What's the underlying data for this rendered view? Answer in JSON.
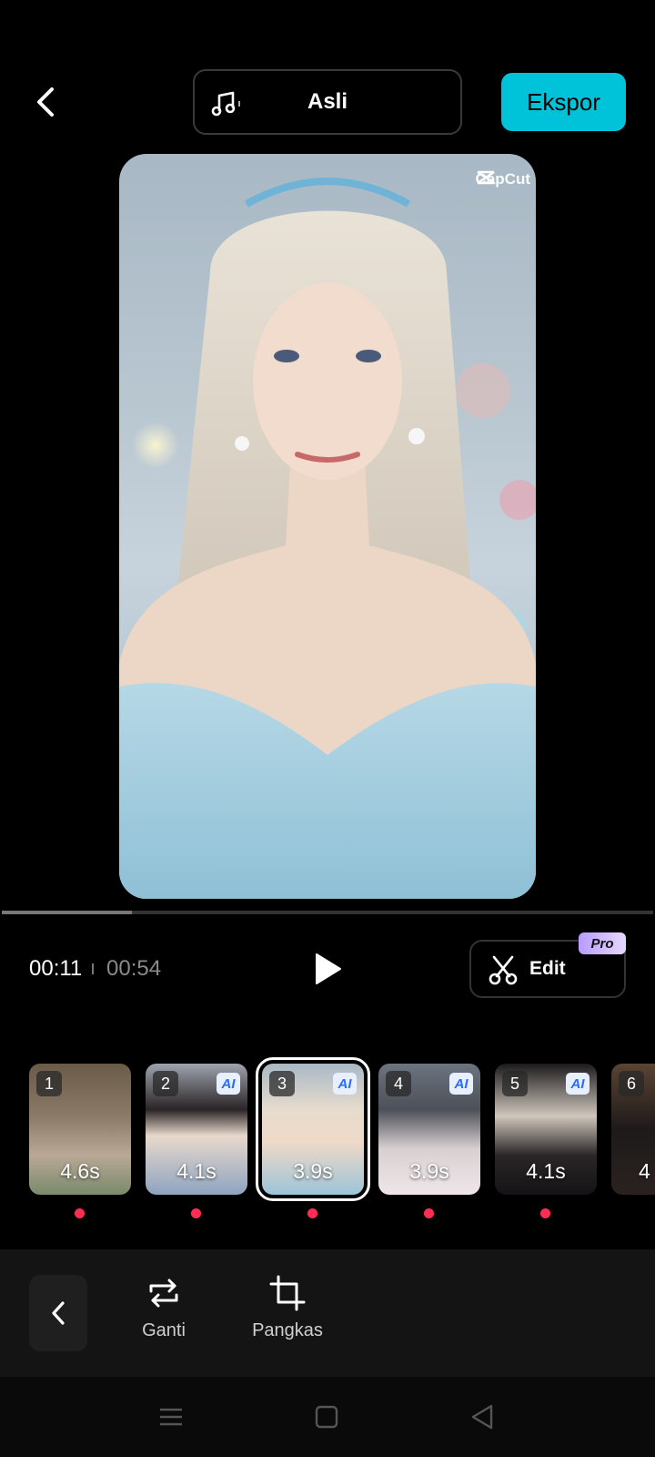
{
  "header": {
    "back_icon": "chevron-left-icon",
    "music_icon": "music-note-icon",
    "music_label": "Asli",
    "export_label": "Ekspor",
    "accent_color": "#00c3d9"
  },
  "preview": {
    "watermark": "CapCut"
  },
  "playback": {
    "current_time": "00:11",
    "total_time": "00:54",
    "progress": 0.2,
    "play_icon": "play-icon"
  },
  "edit": {
    "label": "Edit",
    "badge": "Pro",
    "icon": "scissors-icon"
  },
  "clips": [
    {
      "number": "1",
      "duration": "4.6s",
      "ai": false,
      "selected": false
    },
    {
      "number": "2",
      "duration": "4.1s",
      "ai": true,
      "ai_label": "AI",
      "selected": false
    },
    {
      "number": "3",
      "duration": "3.9s",
      "ai": true,
      "ai_label": "AI",
      "selected": true
    },
    {
      "number": "4",
      "duration": "3.9s",
      "ai": true,
      "ai_label": "AI",
      "selected": false
    },
    {
      "number": "5",
      "duration": "4.1s",
      "ai": true,
      "ai_label": "AI",
      "selected": false
    },
    {
      "number": "6",
      "duration": "4",
      "ai": false,
      "selected": false
    }
  ],
  "toolbar": {
    "collapse_icon": "chevron-left-icon",
    "replace_label": "Ganti",
    "replace_icon": "replace-icon",
    "crop_label": "Pangkas",
    "crop_icon": "crop-icon"
  },
  "system_nav": {
    "menu_icon": "menu-icon",
    "home_icon": "home-square-icon",
    "back_icon": "back-triangle-icon"
  }
}
